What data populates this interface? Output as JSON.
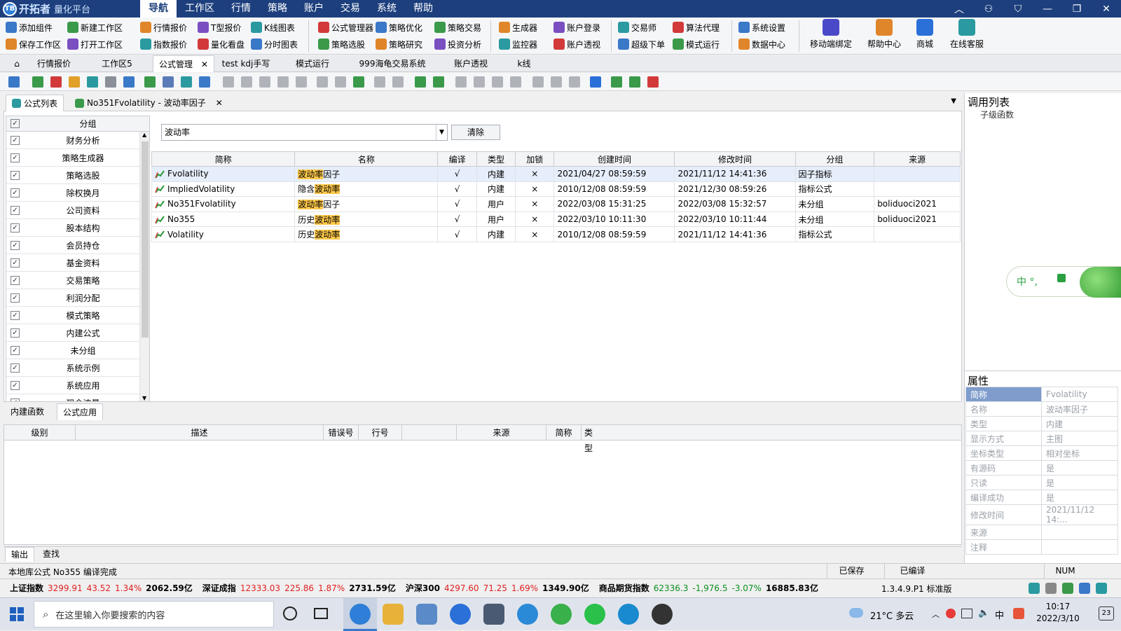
{
  "app": {
    "name": "开拓者",
    "sub": "量化平台",
    "badge": "TB"
  },
  "menu": [
    {
      "label": "导航",
      "active": true
    },
    {
      "label": "工作区"
    },
    {
      "label": "行情"
    },
    {
      "label": "策略"
    },
    {
      "label": "账户"
    },
    {
      "label": "交易"
    },
    {
      "label": "系统"
    },
    {
      "label": "帮助"
    }
  ],
  "ribbon": {
    "row1": [
      "添加组件",
      "新建工作区",
      "行情报价",
      "T型报价",
      "K线图表",
      "公式管理器",
      "策略优化",
      "策略交易",
      "生成器",
      "账户登录",
      "交易师",
      "算法代理",
      "系统设置"
    ],
    "row2": [
      "保存工作区",
      "打开工作区",
      "指数报价",
      "量化看盘",
      "分时图表",
      "策略选股",
      "策略研究",
      "投资分析",
      "监控器",
      "账户透视",
      "超级下单",
      "模式运行",
      "数据中心"
    ],
    "big": [
      "移动端绑定",
      "帮助中心",
      "商城",
      "在线客服"
    ]
  },
  "tabs": [
    {
      "label": "行情报价"
    },
    {
      "label": "工作区5"
    },
    {
      "label": "公式管理",
      "active": true
    },
    {
      "label": "test kdj手写"
    },
    {
      "label": "模式运行"
    },
    {
      "label": "999海龟交易系统"
    },
    {
      "label": "账户透视"
    },
    {
      "label": "k线"
    }
  ],
  "subtabs": [
    {
      "label": "公式列表",
      "active": true
    },
    {
      "label": "No351Fvolatility - 波动率因子"
    }
  ],
  "group_header": "分组",
  "groups": [
    "财务分析",
    "策略生成器",
    "策略选股",
    "除权换月",
    "公司资料",
    "股本结构",
    "会员持仓",
    "基金资料",
    "交易策略",
    "利润分配",
    "模式策略",
    "内建公式",
    "未分组",
    "系统示例",
    "系统应用",
    "现金流量"
  ],
  "search": {
    "value": "波动率",
    "clear": "清除"
  },
  "table": {
    "headers": [
      "简称",
      "名称",
      "编译",
      "类型",
      "加锁",
      "创建时间",
      "修改时间",
      "分组",
      "来源"
    ],
    "rows": [
      {
        "abbr": "Fvolatility",
        "name_pre": "",
        "name_hl": "波动率",
        "name_post": "因子",
        "compiled": "√",
        "type": "内建",
        "locked": "×",
        "created": "2021/04/27 08:59:59",
        "modified": "2021/11/12 14:41:36",
        "group": "因子指标",
        "source": "",
        "selected": true
      },
      {
        "abbr": "ImpliedVolatility",
        "name_pre": "隐含",
        "name_hl": "波动率",
        "name_post": "",
        "compiled": "√",
        "type": "内建",
        "locked": "×",
        "created": "2010/12/08 08:59:59",
        "modified": "2021/12/30 08:59:26",
        "group": "指标公式",
        "source": ""
      },
      {
        "abbr": "No351Fvolatility",
        "name_pre": "",
        "name_hl": "波动率",
        "name_post": "因子",
        "compiled": "√",
        "type": "用户",
        "locked": "×",
        "created": "2022/03/08 15:31:25",
        "modified": "2022/03/08 15:32:57",
        "group": "未分组",
        "source": "boliduoci2021"
      },
      {
        "abbr": "No355",
        "name_pre": "历史",
        "name_hl": "波动率",
        "name_post": "",
        "compiled": "√",
        "type": "用户",
        "locked": "×",
        "created": "2022/03/10 10:11:30",
        "modified": "2022/03/10 10:11:44",
        "group": "未分组",
        "source": "boliduoci2021"
      },
      {
        "abbr": "Volatility",
        "name_pre": "历史",
        "name_hl": "波动率",
        "name_post": "",
        "compiled": "√",
        "type": "内建",
        "locked": "×",
        "created": "2010/12/08 08:59:59",
        "modified": "2021/11/12 14:41:36",
        "group": "指标公式",
        "source": ""
      }
    ]
  },
  "bottom_tabs": [
    {
      "label": "内建函数"
    },
    {
      "label": "公式应用",
      "active": true
    }
  ],
  "err_headers": [
    "级别",
    "描述",
    "错误号",
    "行号",
    "",
    "来源",
    "简称",
    "类型"
  ],
  "out_tabs": [
    "输出",
    "查找"
  ],
  "status": {
    "message": "本地库公式 No355 编译完成",
    "saved": "已保存",
    "compiled": "已编译",
    "num": "NUM"
  },
  "ticker": [
    {
      "name": "上证指数",
      "price": "3299.91",
      "chg": "43.52",
      "pct": "1.34%",
      "vol": "2062.59亿",
      "dir": "up"
    },
    {
      "name": "深证成指",
      "price": "12333.03",
      "chg": "225.86",
      "pct": "1.87%",
      "vol": "2731.59亿",
      "dir": "up"
    },
    {
      "name": "沪深300",
      "price": "4297.60",
      "chg": "71.25",
      "pct": "1.69%",
      "vol": "1349.90亿",
      "dir": "up"
    },
    {
      "name": "商品期货指数",
      "price": "62336.3",
      "chg": "-1,976.5",
      "pct": "-3.07%",
      "vol": "16885.83亿",
      "dir": "down"
    }
  ],
  "version": "1.3.4.9.P1 标准版",
  "right": {
    "calllist": "调用列表",
    "child": "子级函数",
    "props_title": "属性",
    "props": [
      {
        "k": "简称",
        "v": "Fvolatility",
        "active": true
      },
      {
        "k": "名称",
        "v": "波动率因子"
      },
      {
        "k": "类型",
        "v": "内建"
      },
      {
        "k": "显示方式",
        "v": "主图"
      },
      {
        "k": "坐标类型",
        "v": "相对坐标"
      },
      {
        "k": "有源码",
        "v": "是"
      },
      {
        "k": "只读",
        "v": "是"
      },
      {
        "k": "编译成功",
        "v": "是"
      },
      {
        "k": "修改时间",
        "v": "2021/11/12 14:..."
      },
      {
        "k": "来源",
        "v": ""
      },
      {
        "k": "注释",
        "v": ""
      }
    ]
  },
  "ime": {
    "text": "中 °,"
  },
  "taskbar": {
    "search": "在这里输入你要搜索的内容",
    "weather": "21°C 多云",
    "time": "10:17",
    "date": "2022/3/10",
    "ime": "中",
    "notif": "23"
  }
}
